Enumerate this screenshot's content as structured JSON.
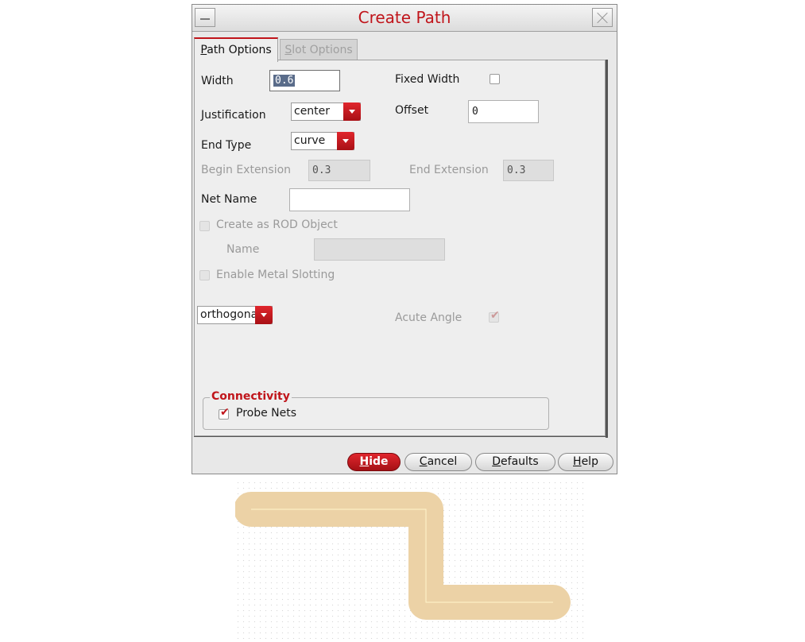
{
  "dialog": {
    "title": "Create Path",
    "tabs": [
      {
        "label_mnemonic": "P",
        "label_rest": "ath Options",
        "active": true
      },
      {
        "label_mnemonic": "S",
        "label_rest": "lot Options",
        "active": false
      }
    ]
  },
  "path_options": {
    "width": {
      "label": "Width",
      "value": "0.6"
    },
    "fixed_width": {
      "label": "Fixed Width",
      "checked": false
    },
    "justification": {
      "label": "Justification",
      "value": "center"
    },
    "offset": {
      "label": "Offset",
      "value": "0"
    },
    "end_type": {
      "label": "End Type",
      "value": "curve"
    },
    "begin_extension": {
      "label": "Begin Extension",
      "value": "0.3"
    },
    "end_extension": {
      "label": "End Extension",
      "value": "0.3"
    },
    "net_name": {
      "label": "Net Name",
      "value": ""
    },
    "create_rod": {
      "label": "Create as ROD Object",
      "checked": false
    },
    "rod_name": {
      "label": "Name",
      "value": ""
    },
    "metal_slotting": {
      "label": "Enable Metal Slotting",
      "checked": false
    },
    "snap_mode": {
      "value": "orthogonal"
    },
    "acute_angle": {
      "label": "Acute Angle",
      "checked": true
    },
    "connectivity": {
      "title": "Connectivity",
      "probe_nets": {
        "label": "Probe Nets",
        "checked": true
      }
    }
  },
  "buttons": {
    "hide": {
      "mnemonic": "H",
      "rest": "ide"
    },
    "cancel": {
      "mnemonic": "C",
      "rest": "ancel"
    },
    "defaults": {
      "mnemonic": "D",
      "rest": "efaults"
    },
    "help": {
      "mnemonic": "H",
      "rest": "elp"
    }
  },
  "colors": {
    "accent": "#c0151b",
    "path_fill": "#ecd2a6",
    "centerline": "#fff6cc"
  },
  "icons": [
    "minimize-icon",
    "close-icon",
    "dropdown-arrow-icon",
    "checkmark-icon"
  ]
}
